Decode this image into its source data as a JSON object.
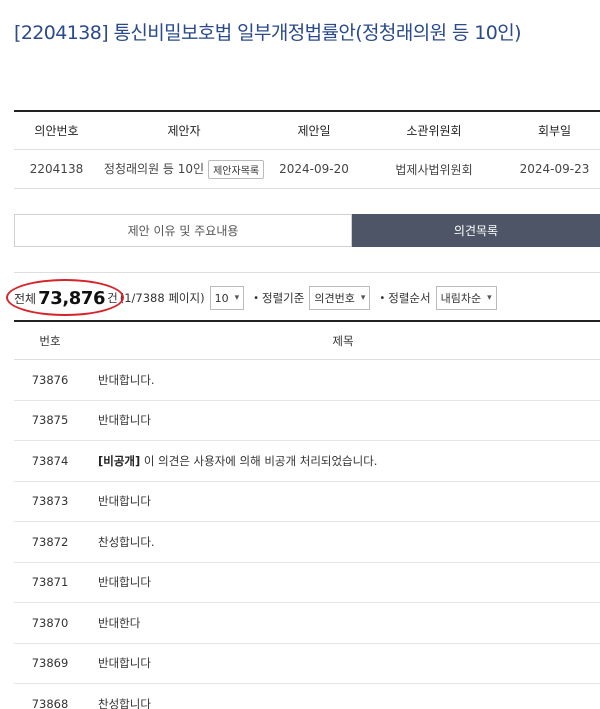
{
  "bill": {
    "title": "[2204138] 통신비밀보호법 일부개정법률안(정청래의원 등 10인)",
    "headers": [
      "의안번호",
      "제안자",
      "제안일",
      "소관위원회",
      "회부일"
    ],
    "number": "2204138",
    "proposer": "정청래의원 등 10인",
    "proposer_list_button": "제안자목록",
    "proposed_date": "2024-09-20",
    "committee": "법제사법위원회",
    "referral_date": "2024-09-23"
  },
  "tabs": {
    "reason": "제안 이유 및 주요내용",
    "opinions": "의견목록"
  },
  "toolbar": {
    "total_label": "전체",
    "total_count": "73,876",
    "unit": "건",
    "pages": "(1/7388 페이지)",
    "page_size": "10",
    "sort_by_label": "정렬기준",
    "sort_by_value": "의견번호",
    "sort_order_label": "정렬순서",
    "sort_order_value": "내림차순",
    "annotation_color": "#d8232a"
  },
  "list": {
    "col_number": "번호",
    "col_title": "제목",
    "rows": [
      {
        "no": "73876",
        "tag": "",
        "title": "반대합니다."
      },
      {
        "no": "73875",
        "tag": "",
        "title": "반대합니다"
      },
      {
        "no": "73874",
        "tag": "[비공개]",
        "title": " 이 의견은 사용자에 의해 비공개 처리되었습니다."
      },
      {
        "no": "73873",
        "tag": "",
        "title": "반대합니다"
      },
      {
        "no": "73872",
        "tag": "",
        "title": "찬성합니다."
      },
      {
        "no": "73871",
        "tag": "",
        "title": "반대합니다"
      },
      {
        "no": "73870",
        "tag": "",
        "title": "반대한다"
      },
      {
        "no": "73869",
        "tag": "",
        "title": "반대합니다"
      },
      {
        "no": "73868",
        "tag": "",
        "title": "찬성합니다"
      }
    ]
  }
}
